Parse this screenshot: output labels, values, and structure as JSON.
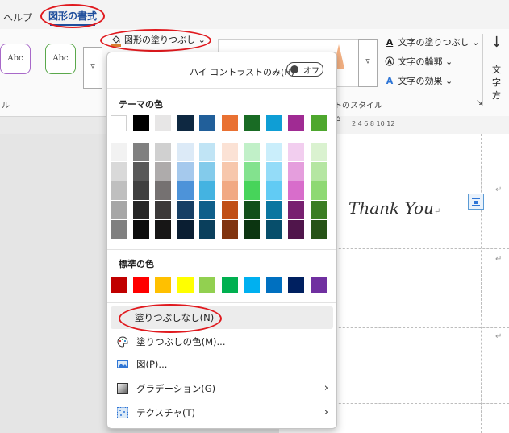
{
  "tabs": {
    "help": "ヘルプ",
    "shape_format": "図形の書式"
  },
  "ribbon": {
    "shape_style_samples": [
      "Abc",
      "Abc"
    ],
    "shape_fill_button": "図形の塗りつぶし",
    "text_fill": "文字の塗りつぶし",
    "text_outline": "文字の輪郭",
    "text_effects": "文字の効果",
    "wordart_group_label": "ートのスタイル",
    "left_group_label": "ル",
    "text_direction_partial": [
      "文字",
      "方"
    ],
    "ruler_ticks": "2  4  6  8  10  12"
  },
  "document": {
    "text": "Thank You"
  },
  "dropdown": {
    "high_contrast_label": "ハイ コントラストのみ(H)",
    "toggle_label": "オフ",
    "theme_colors_title": "テーマの色",
    "standard_colors_title": "標準の色",
    "theme_colors": [
      "#ffffff",
      "#000000",
      "#e7e6e6",
      "#0e2841",
      "#215f9a",
      "#e97132",
      "#196b24",
      "#0f9ed5",
      "#a02b93",
      "#4ea72e"
    ],
    "theme_shades": [
      [
        "#f2f2f2",
        "#808080",
        "#d0d0d0",
        "#dceaf7",
        "#c0e4f5",
        "#fbe2d5",
        "#c1f0c8",
        "#caeefb",
        "#f2ceef",
        "#daf2d0"
      ],
      [
        "#d9d9d9",
        "#595959",
        "#aeabab",
        "#a5c9ed",
        "#83cbeb",
        "#f7c7ac",
        "#83e28e",
        "#94dcf8",
        "#e59edd",
        "#b5e6a2"
      ],
      [
        "#bfbfbf",
        "#404040",
        "#757171",
        "#4d93d9",
        "#44b3e1",
        "#f1a983",
        "#47d45a",
        "#61cbf4",
        "#d86dcb",
        "#8ed973"
      ],
      [
        "#a6a6a6",
        "#262626",
        "#3b3838",
        "#163f65",
        "#0f5f8a",
        "#c04f15",
        "#124f1a",
        "#0b76a0",
        "#782070",
        "#3b7d23"
      ],
      [
        "#808080",
        "#0d0d0d",
        "#171616",
        "#0a1e32",
        "#0a3f5c",
        "#803410",
        "#0c3511",
        "#074e6b",
        "#50154b",
        "#275317"
      ]
    ],
    "standard_colors": [
      "#c00000",
      "#ff0000",
      "#ffc000",
      "#ffff00",
      "#92d050",
      "#00b050",
      "#00b0f0",
      "#0070c0",
      "#002060",
      "#7030a0"
    ],
    "no_fill": "塗りつぶしなし(N)",
    "more_colors": "塗りつぶしの色(M)...",
    "picture": "図(P)...",
    "gradient": "グラデーション(G)",
    "texture": "テクスチャ(T)"
  }
}
